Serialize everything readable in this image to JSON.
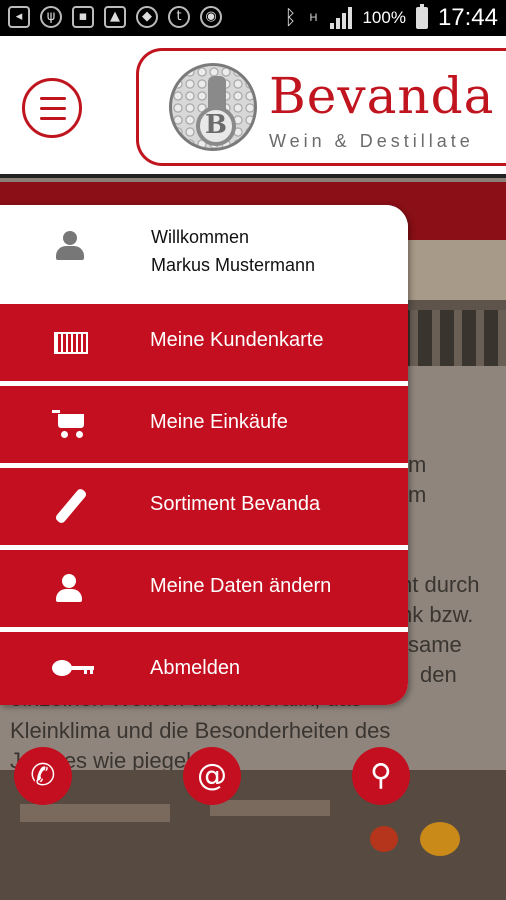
{
  "status_bar": {
    "battery_percent": "100%",
    "time": "17:44",
    "network_label": "H"
  },
  "header": {
    "brand_name": "Bevanda",
    "brand_tagline": "Wein & Destillate",
    "logo_monogram": "B"
  },
  "background": {
    "text_lines": [
      "m",
      "m",
      "nt durch",
      "nk bzw.",
      "same",
      "den",
      "einzelnen Weinen die Mineralik, das",
      "Kleinklima und die Besonderheiten des",
      "J      anges wie      piegeln."
    ]
  },
  "drawer": {
    "greeting_line1": "Willkommen",
    "greeting_line2": "Markus Mustermann",
    "items": [
      {
        "label": "Meine Kundenkarte",
        "icon": "barcode-card-icon"
      },
      {
        "label": "Meine Einkäufe",
        "icon": "cart-icon"
      },
      {
        "label": "Sortiment Bevanda",
        "icon": "bottle-icon"
      },
      {
        "label": "Meine Daten ändern",
        "icon": "person-icon"
      },
      {
        "label": "Abmelden",
        "icon": "key-icon"
      }
    ]
  },
  "actions": [
    {
      "name": "phone",
      "glyph": "✆"
    },
    {
      "name": "email",
      "glyph": "@"
    },
    {
      "name": "location",
      "glyph": "⚲"
    }
  ],
  "colors": {
    "brand_red": "#c30f1f",
    "header_bg": "#ffffff",
    "status_bar_bg": "#000000"
  }
}
